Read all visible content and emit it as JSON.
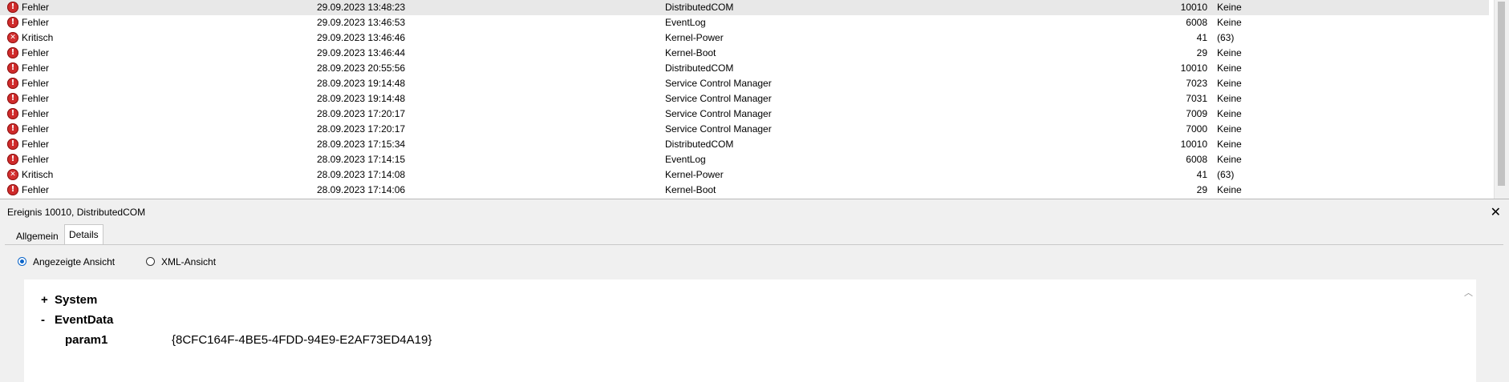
{
  "event_list": {
    "rows": [
      {
        "level": "Fehler",
        "level_type": "error",
        "date": "29.09.2023 13:48:23",
        "source": "DistributedCOM",
        "id": "10010",
        "task": "Keine",
        "selected": true
      },
      {
        "level": "Fehler",
        "level_type": "error",
        "date": "29.09.2023 13:46:53",
        "source": "EventLog",
        "id": "6008",
        "task": "Keine"
      },
      {
        "level": "Kritisch",
        "level_type": "critical",
        "date": "29.09.2023 13:46:46",
        "source": "Kernel-Power",
        "id": "41",
        "task": "(63)"
      },
      {
        "level": "Fehler",
        "level_type": "error",
        "date": "29.09.2023 13:46:44",
        "source": "Kernel-Boot",
        "id": "29",
        "task": "Keine"
      },
      {
        "level": "Fehler",
        "level_type": "error",
        "date": "28.09.2023 20:55:56",
        "source": "DistributedCOM",
        "id": "10010",
        "task": "Keine"
      },
      {
        "level": "Fehler",
        "level_type": "error",
        "date": "28.09.2023 19:14:48",
        "source": "Service Control Manager",
        "id": "7023",
        "task": "Keine"
      },
      {
        "level": "Fehler",
        "level_type": "error",
        "date": "28.09.2023 19:14:48",
        "source": "Service Control Manager",
        "id": "7031",
        "task": "Keine"
      },
      {
        "level": "Fehler",
        "level_type": "error",
        "date": "28.09.2023 17:20:17",
        "source": "Service Control Manager",
        "id": "7009",
        "task": "Keine"
      },
      {
        "level": "Fehler",
        "level_type": "error",
        "date": "28.09.2023 17:20:17",
        "source": "Service Control Manager",
        "id": "7000",
        "task": "Keine"
      },
      {
        "level": "Fehler",
        "level_type": "error",
        "date": "28.09.2023 17:15:34",
        "source": "DistributedCOM",
        "id": "10010",
        "task": "Keine"
      },
      {
        "level": "Fehler",
        "level_type": "error",
        "date": "28.09.2023 17:14:15",
        "source": "EventLog",
        "id": "6008",
        "task": "Keine"
      },
      {
        "level": "Kritisch",
        "level_type": "critical",
        "date": "28.09.2023 17:14:08",
        "source": "Kernel-Power",
        "id": "41",
        "task": "(63)"
      },
      {
        "level": "Fehler",
        "level_type": "error",
        "date": "28.09.2023 17:14:06",
        "source": "Kernel-Boot",
        "id": "29",
        "task": "Keine"
      }
    ]
  },
  "detail": {
    "title": "Ereignis 10010, DistributedCOM",
    "close_icon": "✕",
    "tabs": {
      "general": "Allgemein",
      "details": "Details"
    },
    "view_options": {
      "displayed": "Angezeigte Ansicht",
      "xml": "XML-Ansicht"
    },
    "tree": {
      "system": {
        "toggle": "+",
        "label": "System"
      },
      "event_data": {
        "toggle": "-",
        "label": "EventData"
      },
      "param_name": "param1",
      "param_value": "{8CFC164F-4BE5-4FDD-94E9-E2AF73ED4A19}"
    }
  },
  "colors": {
    "error_icon": "#cf2b2b",
    "radio_accent": "#0a64c8",
    "selected_row": "#e8e8e8"
  }
}
